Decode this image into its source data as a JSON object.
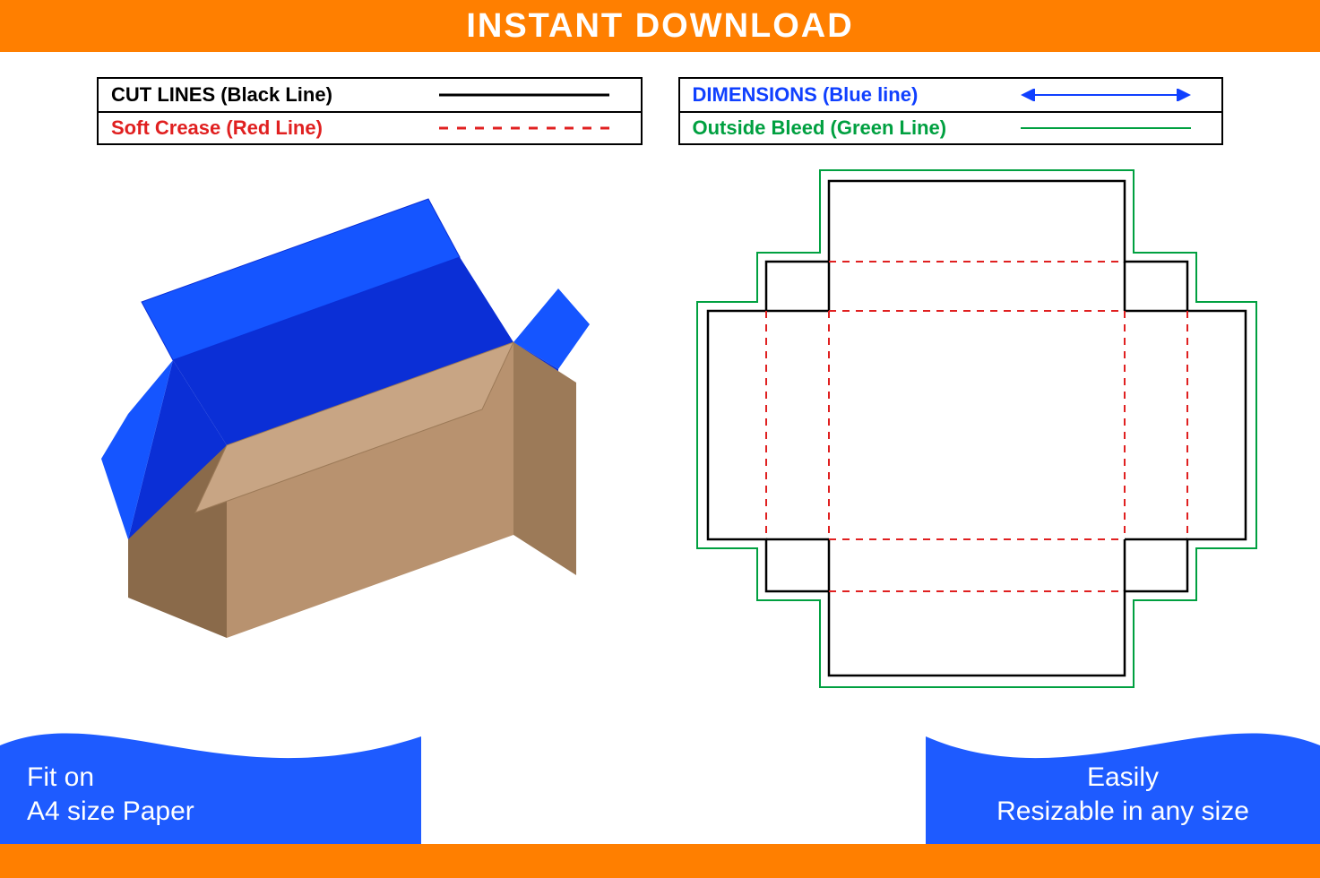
{
  "header": {
    "title": "INSTANT DOWNLOAD"
  },
  "legend": {
    "left": [
      {
        "label": "CUT LINES (Black Line)",
        "color": "#000000",
        "style": "solid"
      },
      {
        "label": "Soft Crease (Red Line)",
        "color": "#e02020",
        "style": "dashed"
      }
    ],
    "right": [
      {
        "label": "DIMENSIONS (Blue line)",
        "color": "#1040ff",
        "style": "arrow"
      },
      {
        "label": "Outside Bleed (Green Line)",
        "color": "#00a040",
        "style": "solid"
      }
    ]
  },
  "box3d": {
    "outside_color": "#b8926f",
    "inside_color": "#1040ff",
    "shade_dark": "#9c7a58",
    "shade_darker": "#8a6a4a"
  },
  "dieline": {
    "cut_color": "#000000",
    "crease_color": "#e02020",
    "bleed_color": "#00a040"
  },
  "badges": {
    "left_line1": "Fit on",
    "left_line2": "A4 size Paper",
    "right_line1": "Easily",
    "right_line2": "Resizable in any size",
    "bg": "#1e5bff"
  },
  "colors": {
    "orange": "#ff7f00",
    "blue": "#1e5bff"
  }
}
